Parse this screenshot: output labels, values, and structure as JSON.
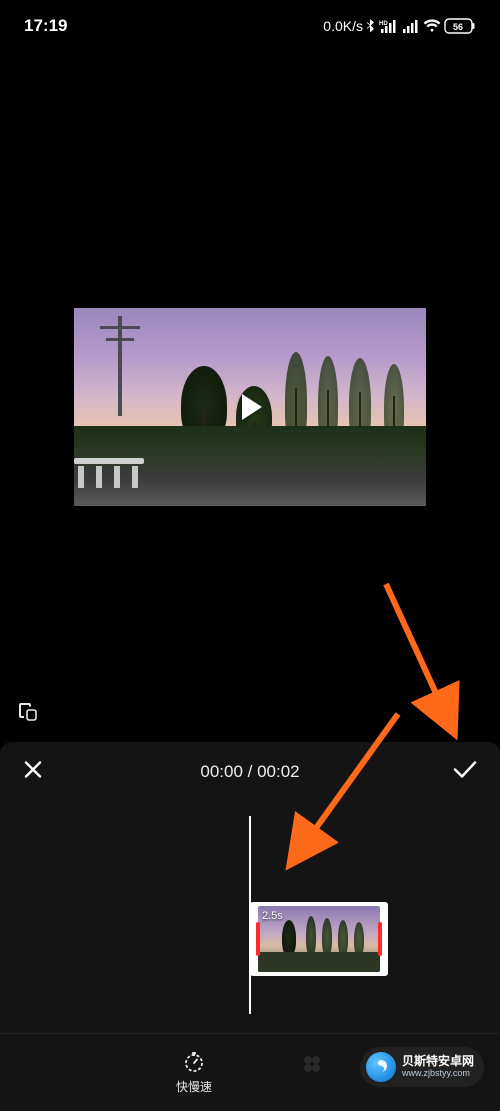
{
  "status": {
    "time": "17:19",
    "net_speed": "0.0K/s",
    "battery": "56"
  },
  "player": {
    "current_time": "00:00",
    "total_time": "00:02"
  },
  "timeline": {
    "clip_duration": "2.5s"
  },
  "tools": {
    "speed_label": "快慢速"
  },
  "watermark": {
    "line1": "贝斯特安卓网",
    "line2": "www.zjbstyy.com"
  }
}
